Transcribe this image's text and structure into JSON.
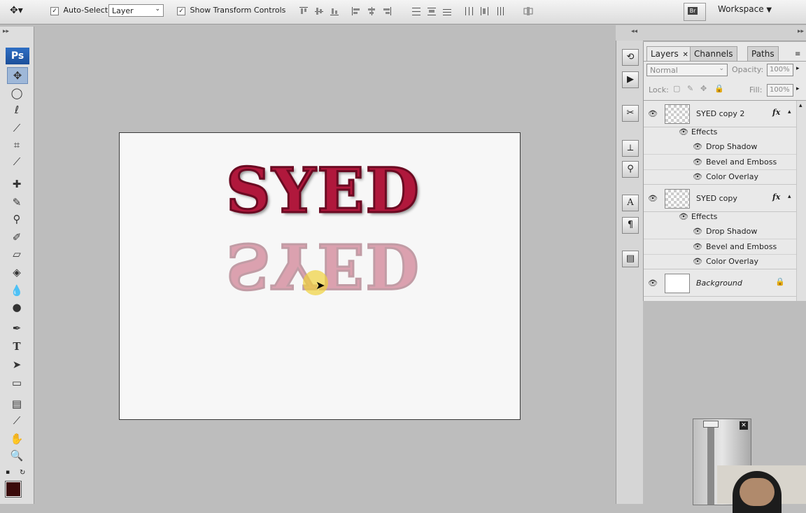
{
  "options_bar": {
    "auto_select_label": "Auto-Select:",
    "auto_select_checked": true,
    "auto_select_value": "Layer",
    "show_transform_label": "Show Transform Controls",
    "show_transform_checked": true,
    "workspace_label": "Workspace"
  },
  "toolbox": {
    "logo": "Ps",
    "tools": [
      "move-tool",
      "ellipse-marquee-tool",
      "lasso-tool",
      "quick-selection-tool",
      "crop-tool",
      "eyedropper-tool",
      "healing-brush-tool",
      "brush-tool",
      "clone-stamp-tool",
      "history-brush-tool",
      "eraser-tool",
      "paint-bucket-tool",
      "blur-tool",
      "dodge-tool",
      "pen-tool",
      "type-tool",
      "path-selection-tool",
      "rectangle-tool",
      "notes-tool",
      "eyedropper-tool-2",
      "hand-tool",
      "zoom-tool"
    ],
    "foreground_color": "#3a0a0a"
  },
  "document": {
    "text": "SYED",
    "text_color": "#b0183c"
  },
  "layers_panel": {
    "tabs": [
      "Layers",
      "Channels",
      "Paths"
    ],
    "blend_mode": "Normal",
    "opacity_label": "Opacity:",
    "opacity_value": "100%",
    "lock_label": "Lock:",
    "fill_label": "Fill:",
    "fill_value": "100%",
    "layers": [
      {
        "name": "SYED copy 2",
        "effects_label": "Effects",
        "effects": [
          "Drop Shadow",
          "Bevel and Emboss",
          "Color Overlay"
        ]
      },
      {
        "name": "SYED copy",
        "effects_label": "Effects",
        "effects": [
          "Drop Shadow",
          "Bevel and Emboss",
          "Color Overlay"
        ]
      }
    ],
    "background_name": "Background"
  }
}
